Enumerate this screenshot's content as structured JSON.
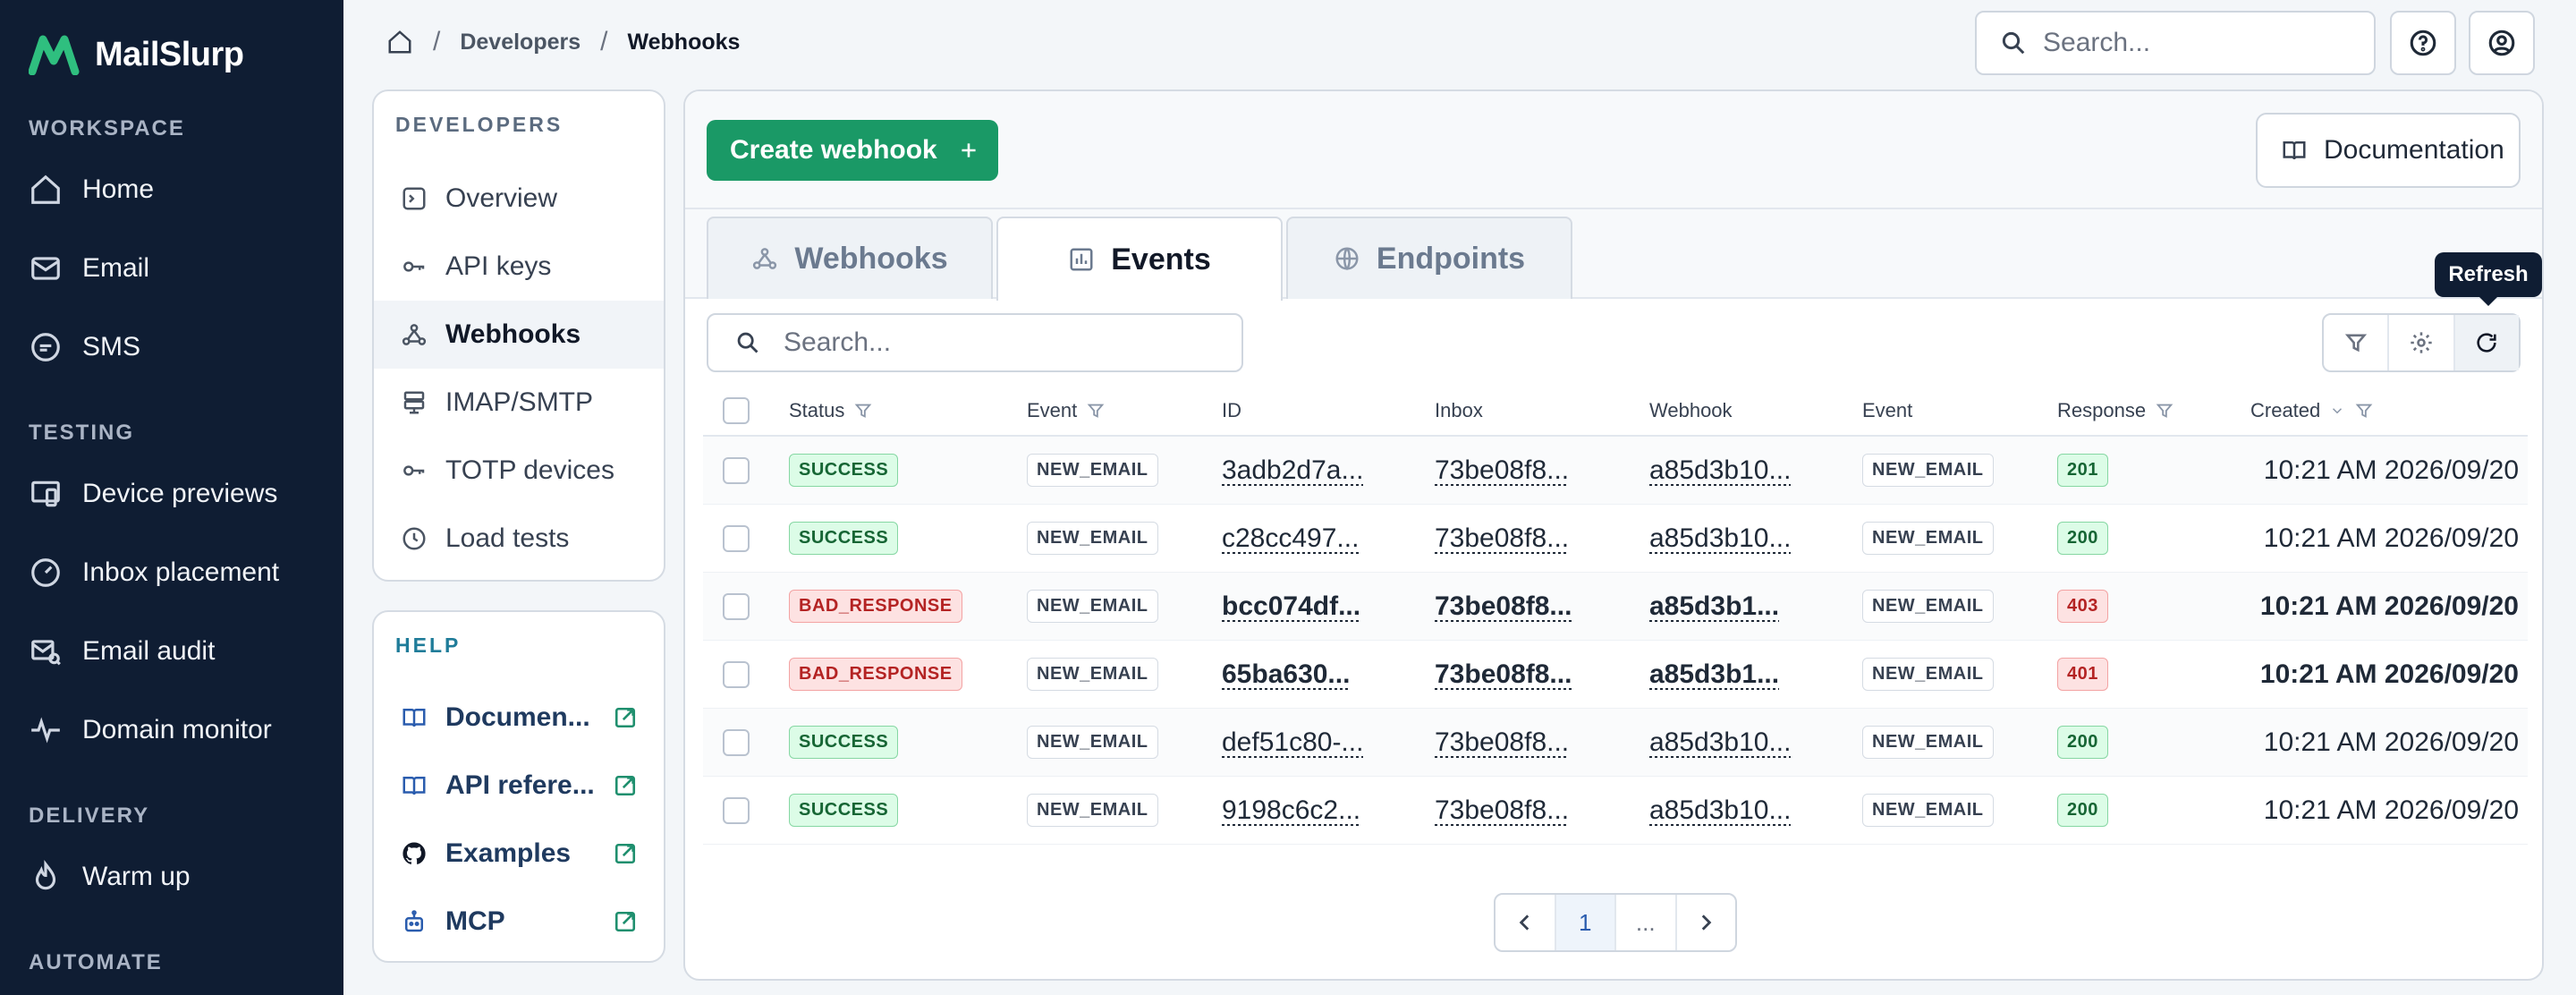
{
  "app": {
    "name": "MailSlurp",
    "brand_color": "#1a9966",
    "sidebar_color": "#0f1d33"
  },
  "sidebar": {
    "sections": [
      {
        "label": "WORKSPACE",
        "items": [
          {
            "label": "Home",
            "icon": "home-icon"
          },
          {
            "label": "Email",
            "icon": "mail-icon"
          },
          {
            "label": "SMS",
            "icon": "chat-icon"
          }
        ]
      },
      {
        "label": "TESTING",
        "items": [
          {
            "label": "Device previews",
            "icon": "devices-icon"
          },
          {
            "label": "Inbox placement",
            "icon": "gauge-icon"
          },
          {
            "label": "Email audit",
            "icon": "mail-search-icon"
          },
          {
            "label": "Domain monitor",
            "icon": "pulse-icon"
          }
        ]
      },
      {
        "label": "DELIVERY",
        "items": [
          {
            "label": "Warm up",
            "icon": "flame-icon"
          }
        ]
      },
      {
        "label": "AUTOMATE",
        "items": []
      }
    ]
  },
  "topbar": {
    "breadcrumb": [
      "Developers",
      "Webhooks"
    ],
    "search_placeholder": "Search..."
  },
  "developers_panel": {
    "title": "DEVELOPERS",
    "items": [
      "Overview",
      "API keys",
      "Webhooks",
      "IMAP/SMTP",
      "TOTP devices",
      "Load tests"
    ],
    "active": "Webhooks"
  },
  "help_panel": {
    "title": "HELP",
    "items": [
      "Documen...",
      "API refere...",
      "Examples",
      "MCP"
    ]
  },
  "main": {
    "create_button": "Create webhook",
    "documentation_button": "Documentation",
    "tabs": [
      "Webhooks",
      "Events",
      "Endpoints"
    ],
    "active_tab": "Events",
    "search_placeholder": "Search...",
    "tooltip": "Refresh",
    "columns": [
      "Status",
      "Event",
      "ID",
      "Inbox",
      "Webhook",
      "Event",
      "Response",
      "Created"
    ],
    "rows": [
      {
        "status": "SUCCESS",
        "event": "NEW_EMAIL",
        "id": "3adb2d7a...",
        "inbox": "73be08f8...",
        "webhook": "a85d3b10...",
        "event2": "NEW_EMAIL",
        "response": "201",
        "created": "10:21 AM 2026/09/20",
        "bold": false
      },
      {
        "status": "SUCCESS",
        "event": "NEW_EMAIL",
        "id": "c28cc497...",
        "inbox": "73be08f8...",
        "webhook": "a85d3b10...",
        "event2": "NEW_EMAIL",
        "response": "200",
        "created": "10:21 AM 2026/09/20",
        "bold": false
      },
      {
        "status": "BAD_RESPONSE",
        "event": "NEW_EMAIL",
        "id": "bcc074df...",
        "inbox": "73be08f8...",
        "webhook": "a85d3b1...",
        "event2": "NEW_EMAIL",
        "response": "403",
        "created": "10:21 AM 2026/09/20",
        "bold": true
      },
      {
        "status": "BAD_RESPONSE",
        "event": "NEW_EMAIL",
        "id": "65ba630...",
        "inbox": "73be08f8...",
        "webhook": "a85d3b1...",
        "event2": "NEW_EMAIL",
        "response": "401",
        "created": "10:21 AM 2026/09/20",
        "bold": true
      },
      {
        "status": "SUCCESS",
        "event": "NEW_EMAIL",
        "id": "def51c80-...",
        "inbox": "73be08f8...",
        "webhook": "a85d3b10...",
        "event2": "NEW_EMAIL",
        "response": "200",
        "created": "10:21 AM 2026/09/20",
        "bold": false
      },
      {
        "status": "SUCCESS",
        "event": "NEW_EMAIL",
        "id": "9198c6c2...",
        "inbox": "73be08f8...",
        "webhook": "a85d3b10...",
        "event2": "NEW_EMAIL",
        "response": "200",
        "created": "10:21 AM 2026/09/20",
        "bold": false
      }
    ],
    "pagination": {
      "current": "1",
      "ellipsis": "..."
    }
  }
}
